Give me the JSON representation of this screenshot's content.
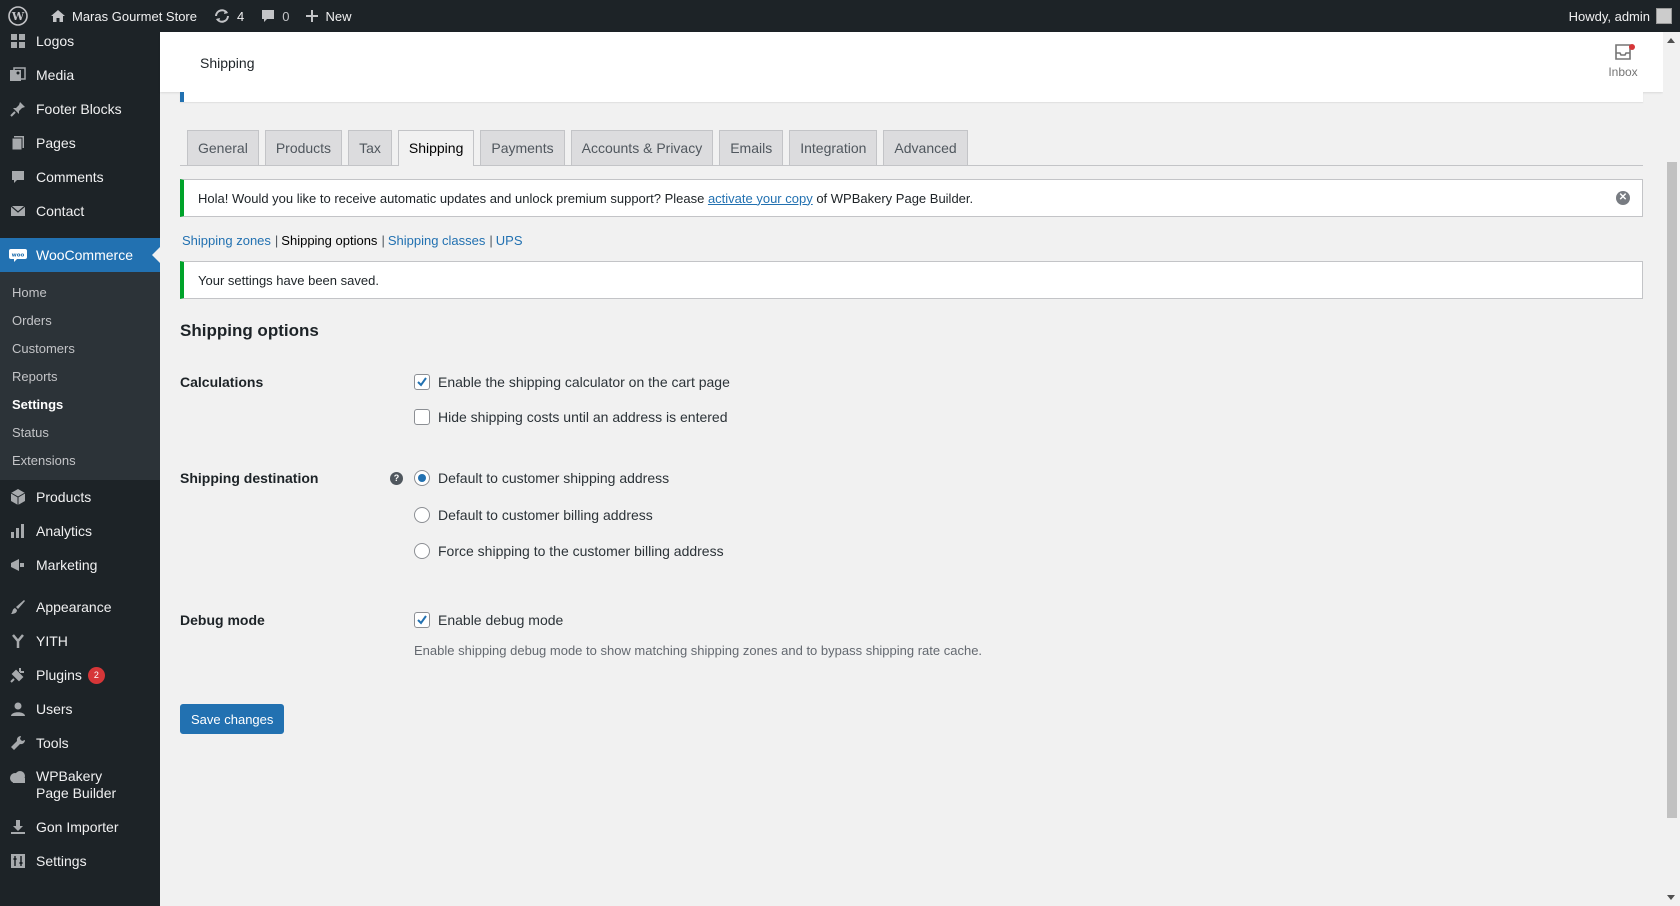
{
  "adminbar": {
    "site_name": "Maras Gourmet Store",
    "updates_count": "4",
    "comments_count": "0",
    "new_label": "New",
    "howdy": "Howdy, admin"
  },
  "sidebar": {
    "items_top": [
      {
        "label": "Logos",
        "icon": "grid-icon"
      },
      {
        "label": "Media",
        "icon": "media-icon"
      },
      {
        "label": "Footer Blocks",
        "icon": "pin-icon"
      },
      {
        "label": "Pages",
        "icon": "pages-icon"
      },
      {
        "label": "Comments",
        "icon": "comment-icon"
      },
      {
        "label": "Contact",
        "icon": "mail-icon"
      }
    ],
    "woocommerce": "WooCommerce",
    "submenu": [
      "Home",
      "Orders",
      "Customers",
      "Reports",
      "Settings",
      "Status",
      "Extensions"
    ],
    "submenu_current": "Settings",
    "items_bottom": [
      {
        "label": "Products",
        "icon": "cube-icon"
      },
      {
        "label": "Analytics",
        "icon": "bar-chart-icon"
      },
      {
        "label": "Marketing",
        "icon": "megaphone-icon"
      },
      {
        "label": "Appearance",
        "icon": "brush-icon"
      },
      {
        "label": "YITH",
        "icon": "yith-icon"
      },
      {
        "label": "Plugins",
        "icon": "plug-icon",
        "badge": "2"
      },
      {
        "label": "Users",
        "icon": "user-icon"
      },
      {
        "label": "Tools",
        "icon": "wrench-icon"
      },
      {
        "label": "WPBakery Page Builder",
        "icon": "cloud-icon"
      },
      {
        "label": "Gon Importer",
        "icon": "download-icon"
      },
      {
        "label": "Settings",
        "icon": "settings-icon"
      }
    ]
  },
  "header": {
    "title": "Shipping",
    "inbox_label": "Inbox"
  },
  "tabs": [
    "General",
    "Products",
    "Tax",
    "Shipping",
    "Payments",
    "Accounts & Privacy",
    "Emails",
    "Integration",
    "Advanced"
  ],
  "active_tab": "Shipping",
  "notice_update": {
    "text_before": "Hola! Would you like to receive automatic updates and unlock premium support? Please ",
    "link": "activate your copy",
    "text_after": " of WPBakery Page Builder."
  },
  "subnav": [
    "Shipping zones",
    "Shipping options",
    "Shipping classes",
    "UPS"
  ],
  "subnav_current": "Shipping options",
  "notice_saved": "Your settings have been saved.",
  "section_title": "Shipping options",
  "calculations": {
    "label": "Calculations",
    "options": [
      {
        "label": "Enable the shipping calculator on the cart page",
        "checked": true
      },
      {
        "label": "Hide shipping costs until an address is entered",
        "checked": false
      }
    ]
  },
  "shipping_destination": {
    "label": "Shipping destination",
    "options": [
      {
        "label": "Default to customer shipping address",
        "selected": true
      },
      {
        "label": "Default to customer billing address",
        "selected": false
      },
      {
        "label": "Force shipping to the customer billing address",
        "selected": false
      }
    ]
  },
  "debug": {
    "label": "Debug mode",
    "option": "Enable debug mode",
    "checked": true,
    "description": "Enable shipping debug mode to show matching shipping zones and to bypass shipping rate cache."
  },
  "save_label": "Save changes",
  "colors": {
    "accent": "#2271b1",
    "sidebar": "#1d2327",
    "success": "#00a32a",
    "badge": "#d63638"
  }
}
